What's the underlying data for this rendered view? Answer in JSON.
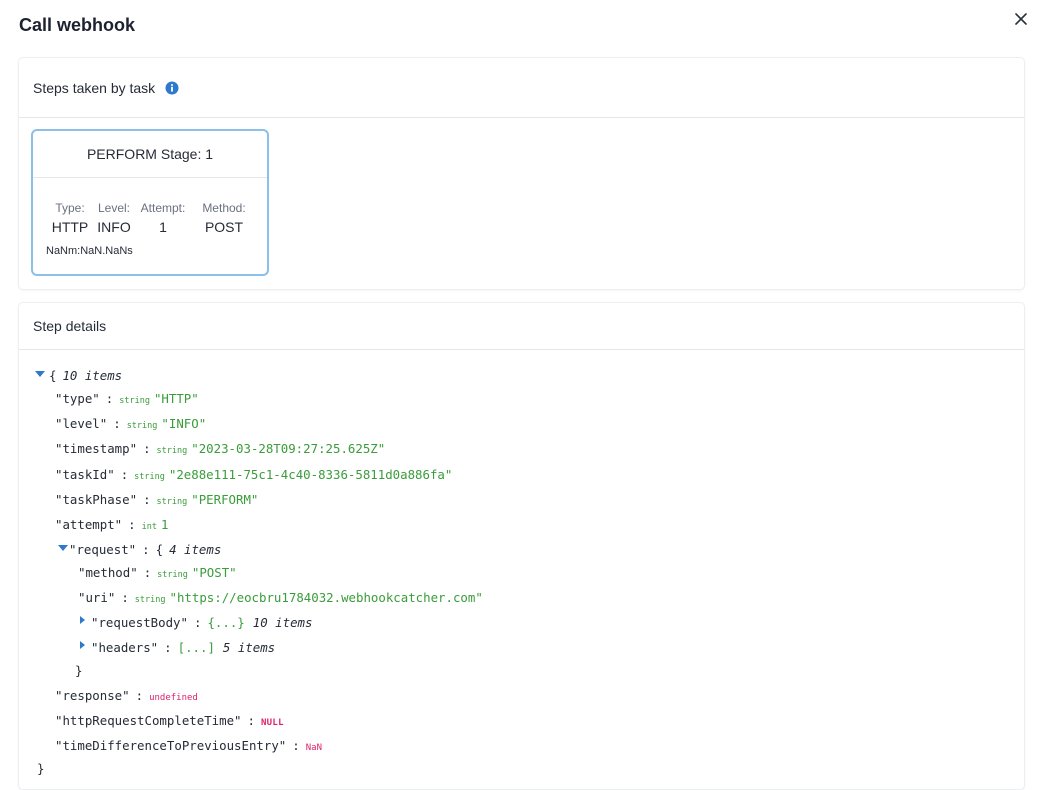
{
  "dialog": {
    "title": "Call webhook",
    "close_icon": "close-icon"
  },
  "steps_card": {
    "header": "Steps taken by task",
    "info_icon": "info-icon",
    "step": {
      "title": "PERFORM Stage: 1",
      "fields": [
        {
          "label": "Type:",
          "value": "HTTP"
        },
        {
          "label": "Level:",
          "value": "INFO"
        },
        {
          "label": "Attempt:",
          "value": "1"
        },
        {
          "label": "Method:",
          "value": "POST"
        }
      ],
      "duration": "NaNm:NaN.NaNs"
    }
  },
  "details_card": {
    "header": "Step details",
    "json": {
      "root_open": "{",
      "root_count": "10 items",
      "root_close": "}",
      "type_key": "\"type\"",
      "type_type": "string",
      "type_val": "\"HTTP\"",
      "level_key": "\"level\"",
      "level_type": "string",
      "level_val": "\"INFO\"",
      "timestamp_key": "\"timestamp\"",
      "timestamp_type": "string",
      "timestamp_val": "\"2023-03-28T09:27:25.625Z\"",
      "taskId_key": "\"taskId\"",
      "taskId_type": "string",
      "taskId_val": "\"2e88e111-75c1-4c40-8336-5811d0a886fa\"",
      "taskPhase_key": "\"taskPhase\"",
      "taskPhase_type": "string",
      "taskPhase_val": "\"PERFORM\"",
      "attempt_key": "\"attempt\"",
      "attempt_type": "int",
      "attempt_val": "1",
      "request_key": "\"request\"",
      "request_open": "{",
      "request_count": "4 items",
      "request_close": "}",
      "method_key": "\"method\"",
      "method_type": "string",
      "method_val": "\"POST\"",
      "uri_key": "\"uri\"",
      "uri_type": "string",
      "uri_val": "\"https://eocbru1784032.webhookcatcher.com\"",
      "requestBody_key": "\"requestBody\"",
      "requestBody_collapsed": "{...}",
      "requestBody_count": "10 items",
      "headers_key": "\"headers\"",
      "headers_collapsed": "[...]",
      "headers_count": "5 items",
      "response_key": "\"response\"",
      "response_val": "undefined",
      "httpRequestCompleteTime_key": "\"httpRequestCompleteTime\"",
      "httpRequestCompleteTime_val": "NULL",
      "timeDifferenceToPreviousEntry_key": "\"timeDifferenceToPreviousEntry\"",
      "timeDifferenceToPreviousEntry_val": "NaN",
      "colon": ":"
    }
  },
  "colors": {
    "accent": "#2f79cc",
    "step_border": "#8cc0e8",
    "json_string": "#3a9c3a",
    "json_special": "#e0206a"
  }
}
